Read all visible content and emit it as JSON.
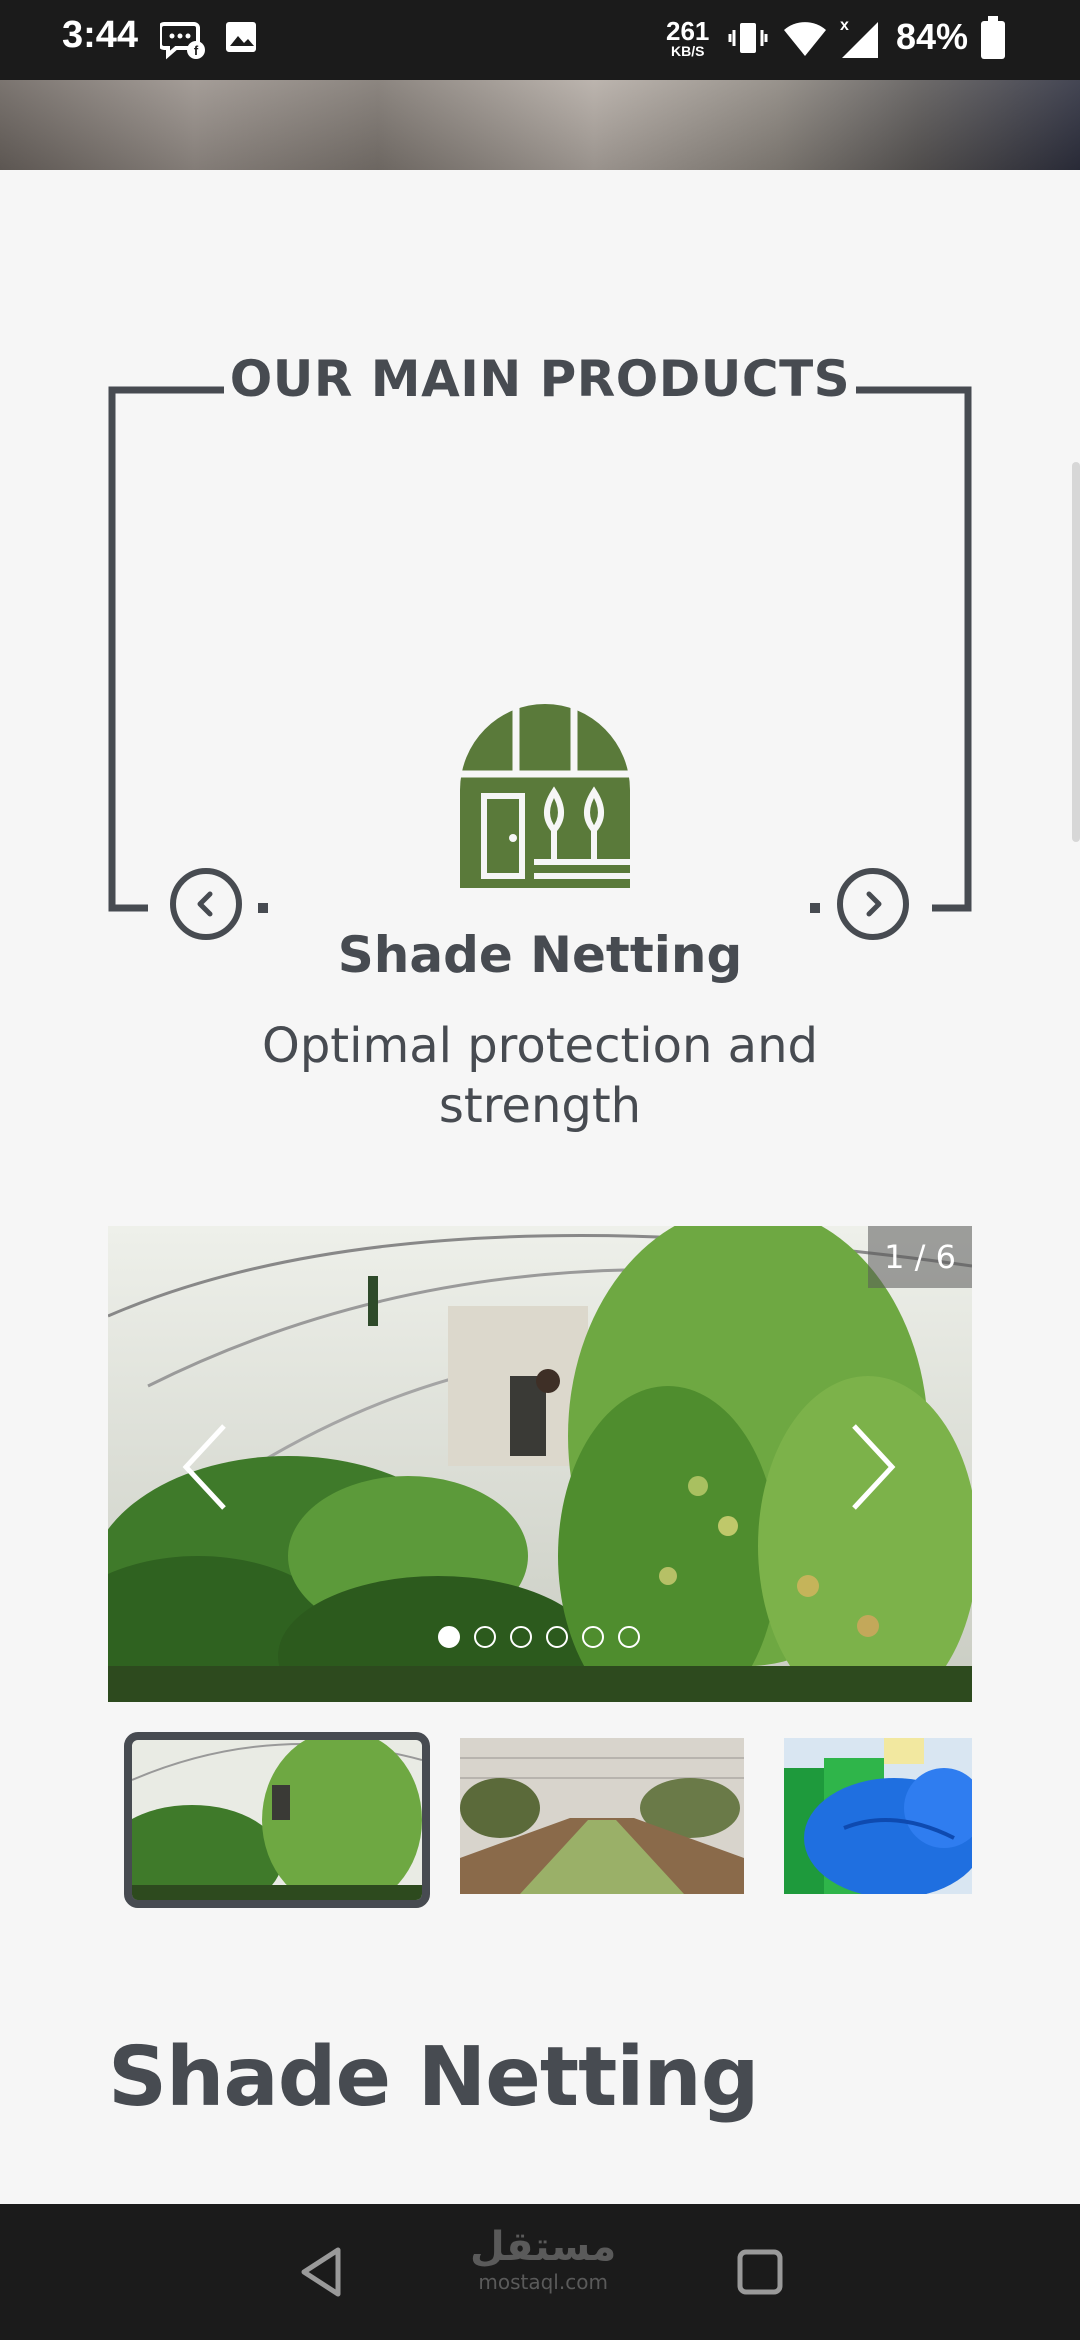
{
  "status_bar": {
    "time": "3:44",
    "net_speed_value": "261",
    "net_speed_unit": "KB/S",
    "battery": "84%"
  },
  "section": {
    "title": "OUR MAIN PRODUCTS"
  },
  "product": {
    "name": "Shade Netting",
    "description": "Optimal protection and strength",
    "icon": "greenhouse-icon",
    "icon_color": "#5a7a3a"
  },
  "gallery": {
    "counter": "1 / 6",
    "total_slides": 6,
    "active_slide": 1,
    "thumbnails": [
      "greenhouse-tomatoes",
      "nursery-rows",
      "blue-green-netting-rolls"
    ]
  },
  "detail": {
    "heading": "Shade Netting"
  },
  "navbar": {
    "watermark_arabic": "مستقل",
    "watermark_latin": "mostaql.com"
  },
  "colors": {
    "text_dark": "#474b51",
    "background": "#f6f6f6",
    "bars": "#1b1b1b"
  }
}
